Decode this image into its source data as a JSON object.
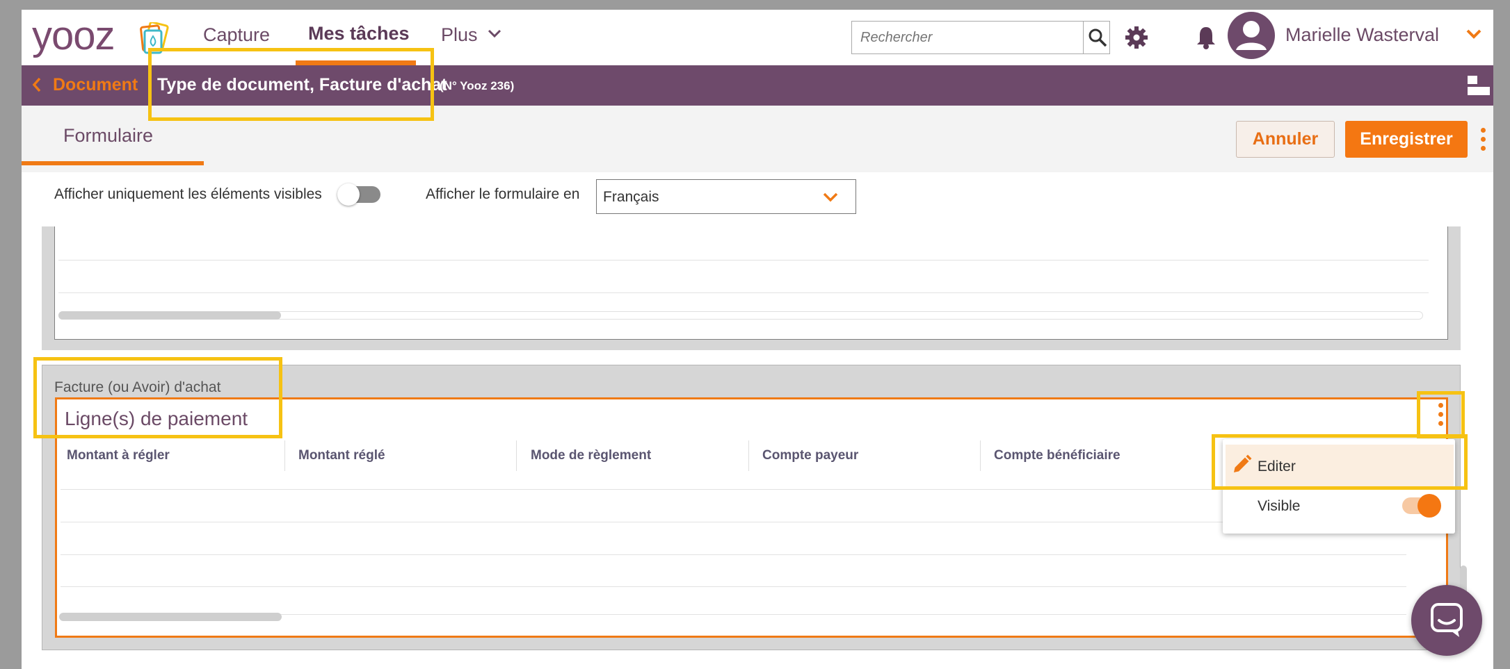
{
  "app": {
    "logo_text": "yooz",
    "nav": {
      "capture": "Capture",
      "mes_taches": "Mes tâches",
      "plus": "Plus"
    },
    "search_placeholder": "Rechercher",
    "user_name": "Marielle Wasterval"
  },
  "breadcrumb": {
    "back_label": "Document",
    "document_title": "Type de document, Facture d'achat",
    "document_number": "(N° Yooz 236)"
  },
  "tabs": {
    "active": "Formulaire"
  },
  "toolbar": {
    "cancel_label": "Annuler",
    "save_label": "Enregistrer"
  },
  "filters": {
    "visible_only_label": "Afficher uniquement les éléments visibles",
    "visible_only_on": false,
    "language_label": "Afficher le formulaire en",
    "language_value": "Français"
  },
  "section": {
    "label": "Facture (ou Avoir) d'achat",
    "card_title": "Ligne(s) de paiement",
    "columns": [
      "Montant à régler",
      "Montant réglé",
      "Mode de règlement",
      "Compte payeur",
      "Compte bénéficiaire"
    ]
  },
  "context_menu": {
    "edit_label": "Editer",
    "visible_label": "Visible",
    "visible_on": true
  },
  "colors": {
    "brand_purple": "#6e4a6b",
    "accent_orange": "#f47712",
    "highlight_yellow": "#f6c213"
  },
  "icons": [
    "chevron-left-icon",
    "chevron-down-icon",
    "search-icon",
    "gear-icon",
    "bell-icon",
    "user-avatar-icon",
    "layout-icon",
    "kebab-icon",
    "pencil-icon",
    "chat-icon"
  ]
}
